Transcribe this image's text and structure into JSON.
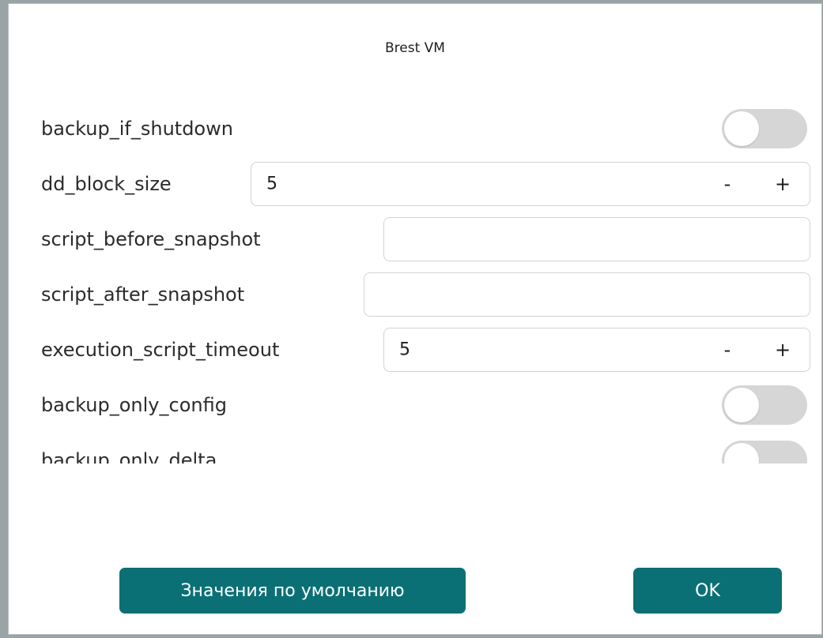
{
  "dialog": {
    "title": "Brest VM"
  },
  "settings": [
    {
      "key": "backup_if_shutdown",
      "type": "toggle",
      "on": false
    },
    {
      "key": "dd_block_size",
      "type": "spin",
      "value": "5",
      "minus": "-",
      "plus": "+"
    },
    {
      "key": "script_before_snapshot",
      "type": "text",
      "value": ""
    },
    {
      "key": "script_after_snapshot",
      "type": "text",
      "value": ""
    },
    {
      "key": "execution_script_timeout",
      "type": "spin",
      "value": "5",
      "minus": "-",
      "plus": "+"
    },
    {
      "key": "backup_only_config",
      "type": "toggle",
      "on": false
    },
    {
      "key": "backup_only_delta",
      "type": "toggle",
      "on": false
    }
  ],
  "footer": {
    "defaults_label": "Значения по умолчанию",
    "ok_label": "OK"
  },
  "colors": {
    "accent": "#0b7075",
    "toggle_off": "#d6d6d6"
  }
}
